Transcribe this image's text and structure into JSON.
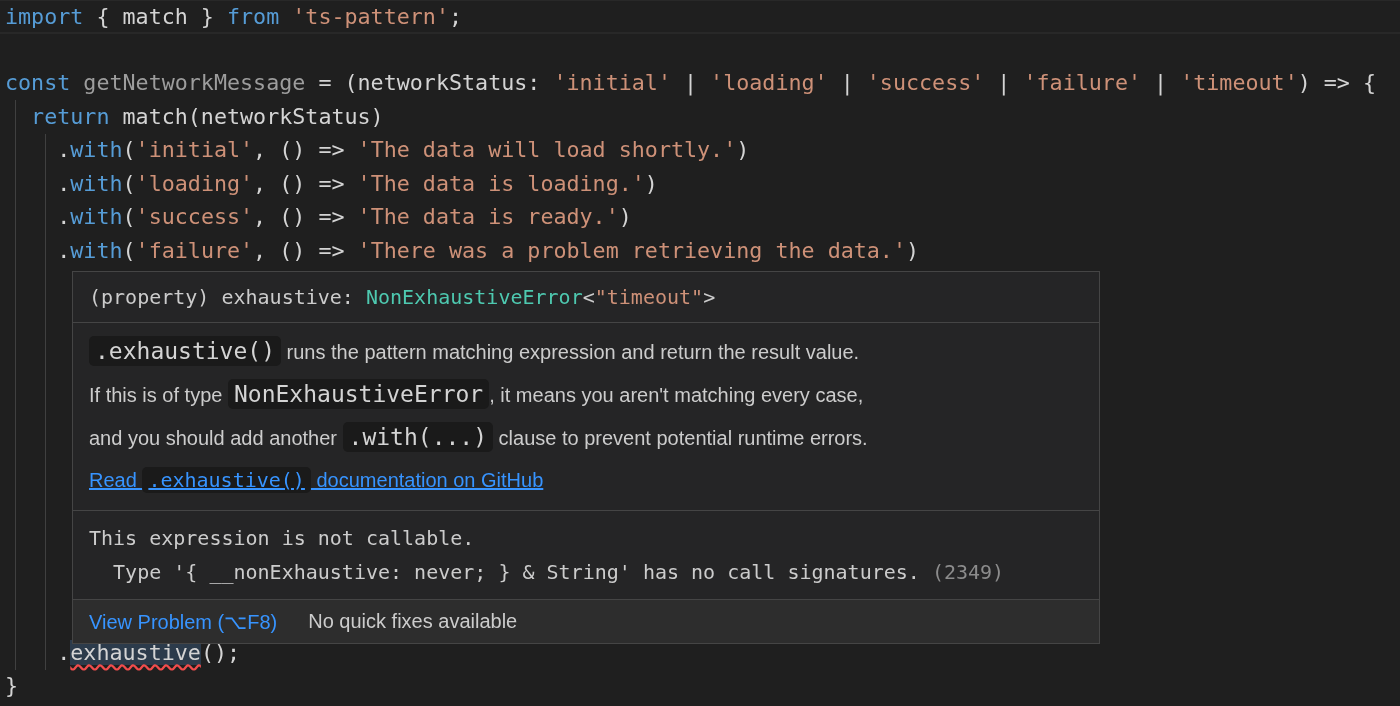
{
  "editor": {
    "blocks": [
      [
        {
          "current_line": true,
          "tokens": [
            {
              "kind": "keyword",
              "text": "import"
            },
            {
              "kind": "plain",
              "text": " { match } "
            },
            {
              "kind": "keyword",
              "text": "from"
            },
            {
              "kind": "string",
              "text": " 'ts-pattern'"
            },
            {
              "kind": "plain",
              "text": ";"
            }
          ]
        }
      ],
      [
        {
          "current_line": false,
          "tokens": [
            {
              "kind": "keyword",
              "text": "const"
            },
            {
              "kind": "unused",
              "text": " getNetworkMessage"
            },
            {
              "kind": "plain",
              "text": " = (networkStatus: "
            },
            {
              "kind": "string",
              "text": "'initial'"
            },
            {
              "kind": "plain",
              "text": " | "
            },
            {
              "kind": "string",
              "text": "'loading'"
            },
            {
              "kind": "plain",
              "text": " | "
            },
            {
              "kind": "string",
              "text": "'success'"
            },
            {
              "kind": "plain",
              "text": " | "
            },
            {
              "kind": "string",
              "text": "'failure'"
            },
            {
              "kind": "plain",
              "text": " | "
            },
            {
              "kind": "string",
              "text": "'timeout'"
            },
            {
              "kind": "plain",
              "text": ") => {"
            }
          ]
        },
        {
          "current_line": false,
          "tokens": [
            {
              "kind": "keyword",
              "text": "  return"
            },
            {
              "kind": "plain",
              "text": " match(networkStatus)"
            }
          ]
        },
        {
          "current_line": false,
          "tokens": [
            {
              "kind": "plain",
              "text": "    ."
            },
            {
              "kind": "keyword",
              "text": "with"
            },
            {
              "kind": "plain",
              "text": "("
            },
            {
              "kind": "string",
              "text": "'initial'"
            },
            {
              "kind": "plain",
              "text": ", () => "
            },
            {
              "kind": "string",
              "text": "'The data will load shortly.'"
            },
            {
              "kind": "plain",
              "text": ")"
            }
          ]
        },
        {
          "current_line": false,
          "tokens": [
            {
              "kind": "plain",
              "text": "    ."
            },
            {
              "kind": "keyword",
              "text": "with"
            },
            {
              "kind": "plain",
              "text": "("
            },
            {
              "kind": "string",
              "text": "'loading'"
            },
            {
              "kind": "plain",
              "text": ", () => "
            },
            {
              "kind": "string",
              "text": "'The data is loading.'"
            },
            {
              "kind": "plain",
              "text": ")"
            }
          ]
        },
        {
          "current_line": false,
          "tokens": [
            {
              "kind": "plain",
              "text": "    ."
            },
            {
              "kind": "keyword",
              "text": "with"
            },
            {
              "kind": "plain",
              "text": "("
            },
            {
              "kind": "string",
              "text": "'success'"
            },
            {
              "kind": "plain",
              "text": ", () => "
            },
            {
              "kind": "string",
              "text": "'The data is ready.'"
            },
            {
              "kind": "plain",
              "text": ")"
            }
          ]
        },
        {
          "current_line": false,
          "tokens": [
            {
              "kind": "plain",
              "text": "    ."
            },
            {
              "kind": "keyword",
              "text": "with"
            },
            {
              "kind": "plain",
              "text": "("
            },
            {
              "kind": "string",
              "text": "'failure'"
            },
            {
              "kind": "plain",
              "text": ", () => "
            },
            {
              "kind": "string",
              "text": "'There was a problem retrieving the data.'"
            },
            {
              "kind": "plain",
              "text": ")"
            }
          ]
        }
      ]
    ],
    "lines_below_hover": [
      {
        "current_line": false,
        "tokens": [
          {
            "kind": "plain",
            "text": "    ."
          },
          {
            "kind": "error",
            "text": "exhaustive"
          },
          {
            "kind": "plain",
            "text": "();"
          }
        ]
      },
      {
        "current_line": false,
        "tokens": [
          {
            "kind": "plain",
            "text": "}"
          }
        ]
      }
    ]
  },
  "hover": {
    "signature": [
      {
        "kind": "plain",
        "text": "(property) exhaustive: "
      },
      {
        "kind": "type",
        "text": "NonExhaustiveError"
      },
      {
        "kind": "plain",
        "text": "<"
      },
      {
        "kind": "string",
        "text": "\"timeout\""
      },
      {
        "kind": "plain",
        "text": ">"
      }
    ],
    "doc_paragraphs": [
      [
        {
          "kind": "code",
          "text": ".exhaustive()"
        },
        {
          "kind": "text",
          "text": " runs the pattern matching expression and return the result value."
        }
      ],
      [
        {
          "kind": "text",
          "text": "If this is of type "
        },
        {
          "kind": "code",
          "text": "NonExhaustiveError"
        },
        {
          "kind": "text",
          "text": ", it means you aren't matching every case,"
        }
      ],
      [
        {
          "kind": "text",
          "text": "and you should add another "
        },
        {
          "kind": "code",
          "text": ".with(...)"
        },
        {
          "kind": "text",
          "text": " clause to prevent potential runtime errors."
        }
      ]
    ],
    "doc_link": [
      {
        "kind": "text",
        "text": "Read "
      },
      {
        "kind": "code",
        "text": ".exhaustive()"
      },
      {
        "kind": "text",
        "text": " documentation on GitHub"
      }
    ],
    "error_message": "This expression is not callable.",
    "error_detail": "  Type '{ __nonExhaustive: never; } & String' has no call signatures.",
    "error_code": "(2349)",
    "view_problem": "View Problem (⌥F8)",
    "quick_fix_status": "No quick fixes available"
  }
}
